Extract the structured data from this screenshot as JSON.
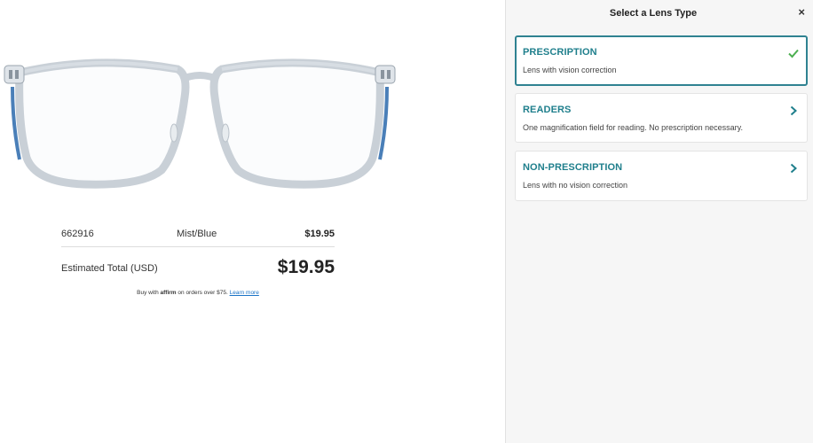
{
  "product": {
    "sku": "662916",
    "color": "Mist/Blue",
    "price": "$19.95"
  },
  "total": {
    "label": "Estimated Total (USD)",
    "amount": "$19.95"
  },
  "affirm": {
    "prefix": "Buy with",
    "brand": "affirm",
    "suffix": "on orders over $75.",
    "link": "Learn more"
  },
  "panel": {
    "title": "Select a Lens Type",
    "close": "×",
    "options": [
      {
        "title": "PRESCRIPTION",
        "desc": "Lens with vision correction",
        "selected": true,
        "icon": "check-icon"
      },
      {
        "title": "READERS",
        "desc": "One magnification field for reading. No prescription necessary.",
        "selected": false,
        "icon": "chevron-right-icon"
      },
      {
        "title": "NON-PRESCRIPTION",
        "desc": "Lens with no vision correction",
        "selected": false,
        "icon": "chevron-right-icon"
      }
    ]
  },
  "colors": {
    "accent": "#1f7f8c",
    "selected_border": "#2f8291",
    "check": "#4caf50",
    "link": "#1a73c6",
    "frame_blue": "#4a7fb8"
  }
}
